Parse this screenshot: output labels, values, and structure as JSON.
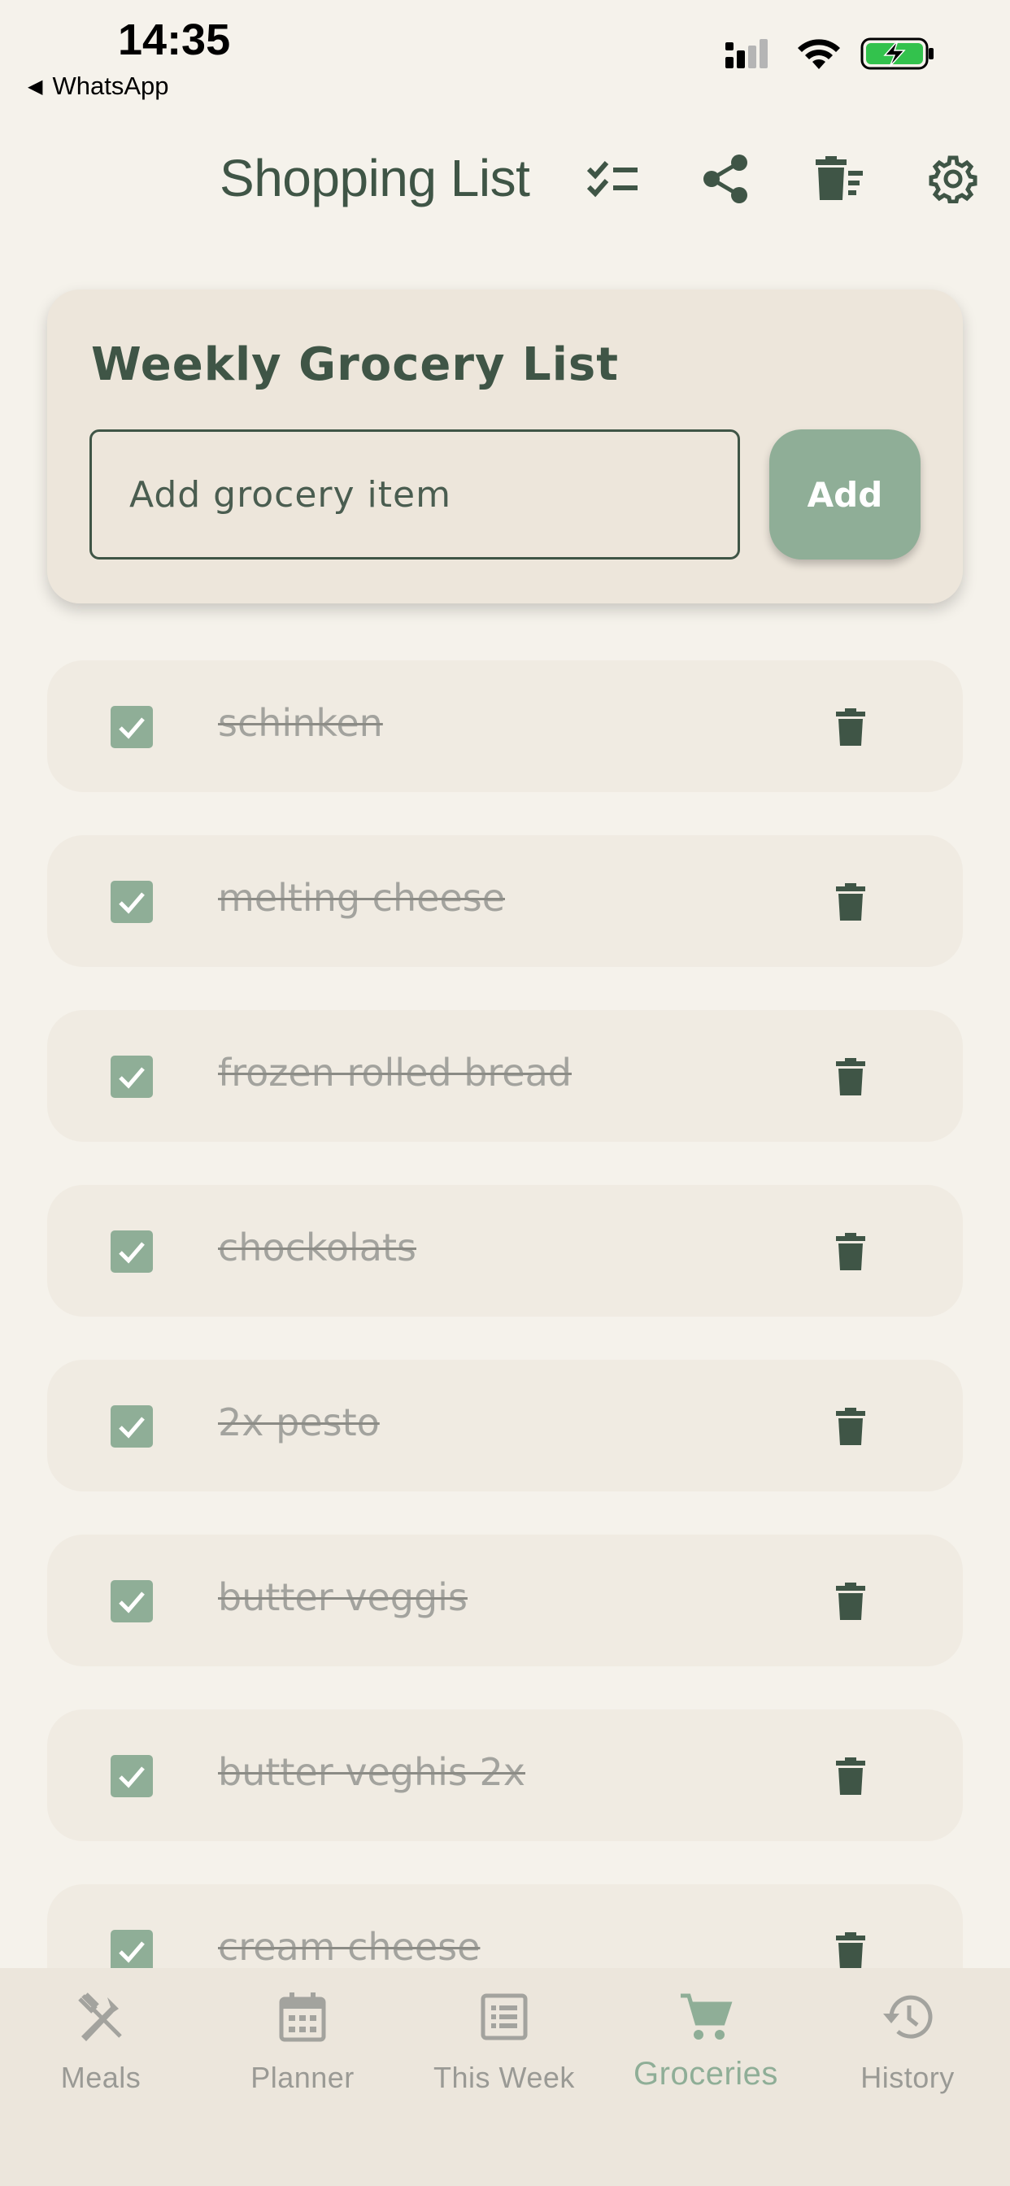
{
  "status_bar": {
    "time": "14:35",
    "back_app": "WhatsApp",
    "icons": [
      "signal-icon",
      "wifi-icon",
      "battery-charging-icon"
    ]
  },
  "header": {
    "title": "Shopping List",
    "actions": [
      "check-all-icon",
      "share-icon",
      "clear-list-icon",
      "settings-icon"
    ]
  },
  "card": {
    "title": "Weekly Grocery List",
    "input_placeholder": "Add grocery item",
    "input_value": "",
    "add_label": "Add"
  },
  "items": [
    {
      "label": "schinken",
      "checked": true
    },
    {
      "label": "melting cheese",
      "checked": true
    },
    {
      "label": "frozen rolled bread",
      "checked": true
    },
    {
      "label": "chockolats",
      "checked": true
    },
    {
      "label": "2x pesto",
      "checked": true
    },
    {
      "label": "butter veggis",
      "checked": true
    },
    {
      "label": "butter veghis 2x",
      "checked": true
    },
    {
      "label": "cream cheese",
      "checked": true
    }
  ],
  "nav": [
    {
      "label": "Meals",
      "icon": "fork-knife-icon",
      "active": false
    },
    {
      "label": "Planner",
      "icon": "calendar-icon",
      "active": false
    },
    {
      "label": "This Week",
      "icon": "list-icon",
      "active": false
    },
    {
      "label": "Groceries",
      "icon": "cart-icon",
      "active": true
    },
    {
      "label": "History",
      "icon": "history-icon",
      "active": false
    }
  ],
  "colors": {
    "background": "#f5f2eb",
    "primary": "#3f5546",
    "accent": "#8fae97",
    "card": "#ede6db",
    "item": "#f0ebe2"
  }
}
